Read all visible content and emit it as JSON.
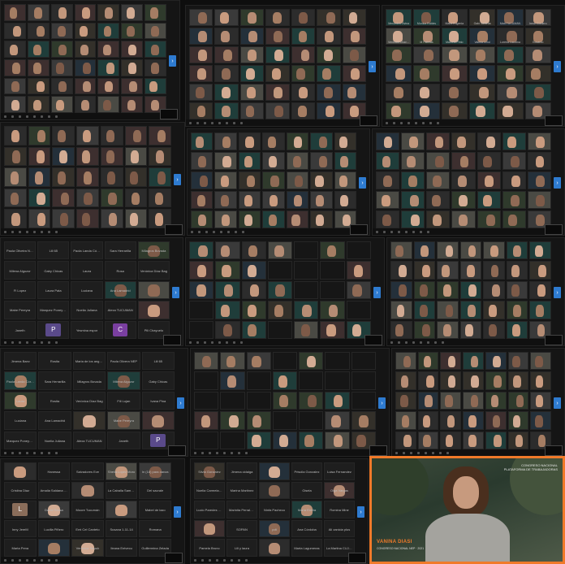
{
  "panels": {
    "p1": {
      "arrow": "›"
    },
    "p2": {
      "names": [
        "Mercedes Vivina",
        "",
        "Maria Eugenia",
        "",
        "Gabi Valdetta",
        "",
        "Matt TUCUMAN",
        "Irene Cordero"
      ]
    },
    "p3": {
      "names": [
        "Mercedes Vivina",
        "Monica Robles",
        "Maria Eugenia",
        "Gabi Valdetta",
        "Matt TUCUMAN",
        "Irene Cordero",
        "Verónica Chavarri",
        "M Palletas",
        "Marcela Pinto",
        "Valeria Leroi",
        "Lorena Lacolina",
        "Eduardo"
      ]
    },
    "p7": {
      "names": [
        "Paola Oliveira NEP",
        "Lili 65",
        "Paola Landa Córdoba",
        "Sara Herrarilla",
        "Milagros Bovada",
        "Milena Alguzor",
        "Gaby Chicas",
        "Laura",
        "Rosa",
        "Verónica Díaz Bag",
        "Fi Lopez",
        "Laura Pata",
        "Luciana",
        "Ana Lamadrid",
        "",
        "Mabe Pereyra",
        "Marquez Poneywoens",
        "Noelia Juliana",
        "Alexa TUCUMAN",
        "",
        "Janeth",
        "P",
        "Yesmina espor",
        "C",
        "Pili Chayuelo"
      ]
    },
    "p10": {
      "names": [
        "Jimena Baez",
        "Rosita",
        "Maria de los angeles",
        "Paola Olivera NEP",
        "Lili 65",
        "Paola Landa Córdoba",
        "Sara Herrarilla",
        "Milagros Bovada",
        "Milena Alguzor",
        "Gaby Chicas",
        "Laura",
        "Rosita",
        "Verónica Díaz Bag",
        "Fili Lujan",
        "Ivana Pina",
        "Luciana",
        "Ana Lamadrid",
        "",
        "Mabe Pereyra",
        "",
        "Marquez Poneywoens",
        "Noelia Juliana",
        "Alexa TUCUMAN",
        "Janeth",
        "P"
      ]
    },
    "p13": {
      "names": [
        "",
        "Hanessa",
        "Salvadores Eve",
        "Sheila Lopez Moro",
        "In (18) para danza",
        "Cristina Diaz",
        "Amalia Saldana Estrella",
        "",
        "La Caballa Samuel",
        "Del sacrale",
        "L",
        "David Rossa",
        "Moore Tucumán",
        "",
        "Mabel de lazo",
        "Inny JereM",
        "Lucilla Piñero",
        "Emi Cel Canteto",
        "Susana 1-11-14",
        "Romana",
        "Marta Pena",
        "",
        "Verónica Tarpuk",
        "Ileana Entvecu",
        "Guillermina Zelada"
      ]
    },
    "p14": {
      "names": [
        "Silvia Gonzalez",
        "Jimena cidalga",
        "",
        "Priscila Gonzalez",
        "Luisa Fernandez",
        "Noelia Carmela G Ruiz",
        "Marina Martinez",
        "",
        "Gisela",
        "Olga Vargas",
        "Lucio Paredes Tucumán",
        "Marinita Perraleguia",
        "Ninfa Pacheco",
        "María Emilia",
        "Romina Mine",
        "",
        "SOPAN",
        "pdt",
        "Ana Córdoba",
        "Ali zanicia plus",
        "Pamela Bruno",
        "Lili y laura",
        "",
        "Marta Lagumeras",
        "La Martina CUJMA"
      ]
    }
  },
  "live": {
    "speaker": "VANINA DIASI",
    "speaker_role": "CONGRESO NACIONAL NEP · 2021",
    "event_line1": "CONGRESO NACIONAL",
    "event_line2": "PLATAFORMA DE TRABAJADORAS"
  }
}
